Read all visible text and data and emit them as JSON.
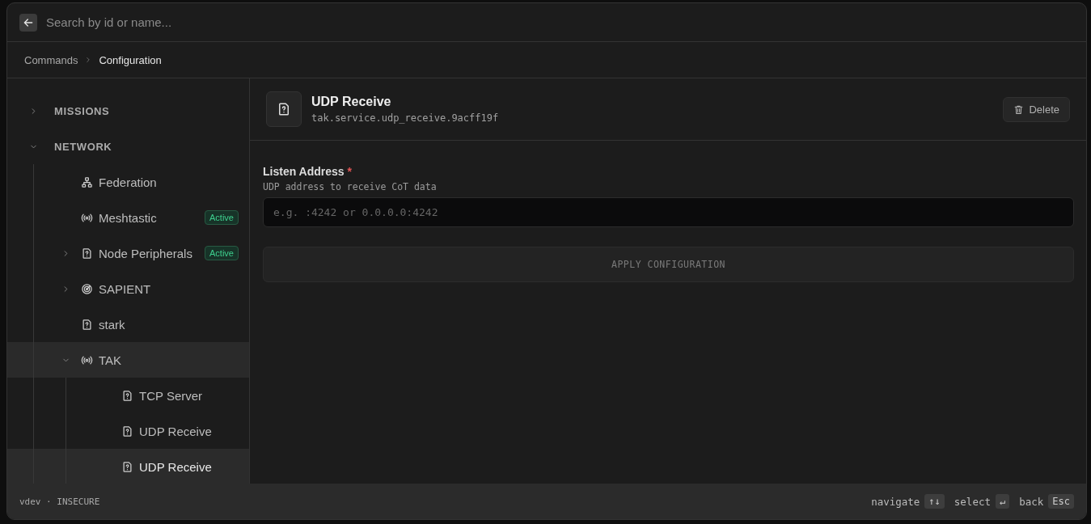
{
  "search": {
    "placeholder": "Search by id or name..."
  },
  "breadcrumb": [
    {
      "label": "Commands",
      "current": false
    },
    {
      "label": "Configuration",
      "current": true
    }
  ],
  "tree": [
    {
      "label": "MISSIONS",
      "kind": "section",
      "expanded": false,
      "selected": false,
      "hovered": false
    },
    {
      "label": "NETWORK",
      "kind": "section",
      "expanded": true,
      "selected": false,
      "hovered": false,
      "children": [
        {
          "label": "Federation",
          "kind": "hub",
          "selected": false,
          "hovered": false
        },
        {
          "label": "Meshtastic",
          "kind": "radio",
          "selected": false,
          "hovered": false,
          "badge": "Active"
        },
        {
          "label": "Node Peripherals",
          "kind": "service",
          "expanded": false,
          "selected": false,
          "hovered": false,
          "badge": "Active"
        },
        {
          "label": "SAPIENT",
          "kind": "radar",
          "expanded": false,
          "selected": false,
          "hovered": false
        },
        {
          "label": "stark",
          "kind": "service",
          "selected": false,
          "hovered": false
        },
        {
          "label": "TAK",
          "kind": "radio",
          "expanded": true,
          "selected": false,
          "hovered": true,
          "children": [
            {
              "label": "TCP Server",
              "kind": "service",
              "selected": false,
              "hovered": false
            },
            {
              "label": "UDP Receive",
              "kind": "service",
              "selected": false,
              "hovered": false
            },
            {
              "label": "UDP Receive",
              "kind": "service",
              "selected": true,
              "hovered": false
            }
          ]
        }
      ]
    }
  ],
  "detail": {
    "title": "UDP Receive",
    "id": "tak.service.udp_receive.9acff19f",
    "delete_label": "Delete",
    "fields": [
      {
        "label": "Listen Address",
        "required_mark": "*",
        "help": "UDP address to receive CoT data",
        "placeholder": "e.g. :4242 or 0.0.0.0:4242"
      }
    ],
    "apply_label": "APPLY CONFIGURATION",
    "apply_disabled": true
  },
  "status": {
    "text": "vdev · INSECURE"
  },
  "hints": [
    {
      "label": "navigate",
      "key": "↑↓"
    },
    {
      "label": "select",
      "key": "↵"
    },
    {
      "label": "back",
      "key": "Esc"
    }
  ]
}
